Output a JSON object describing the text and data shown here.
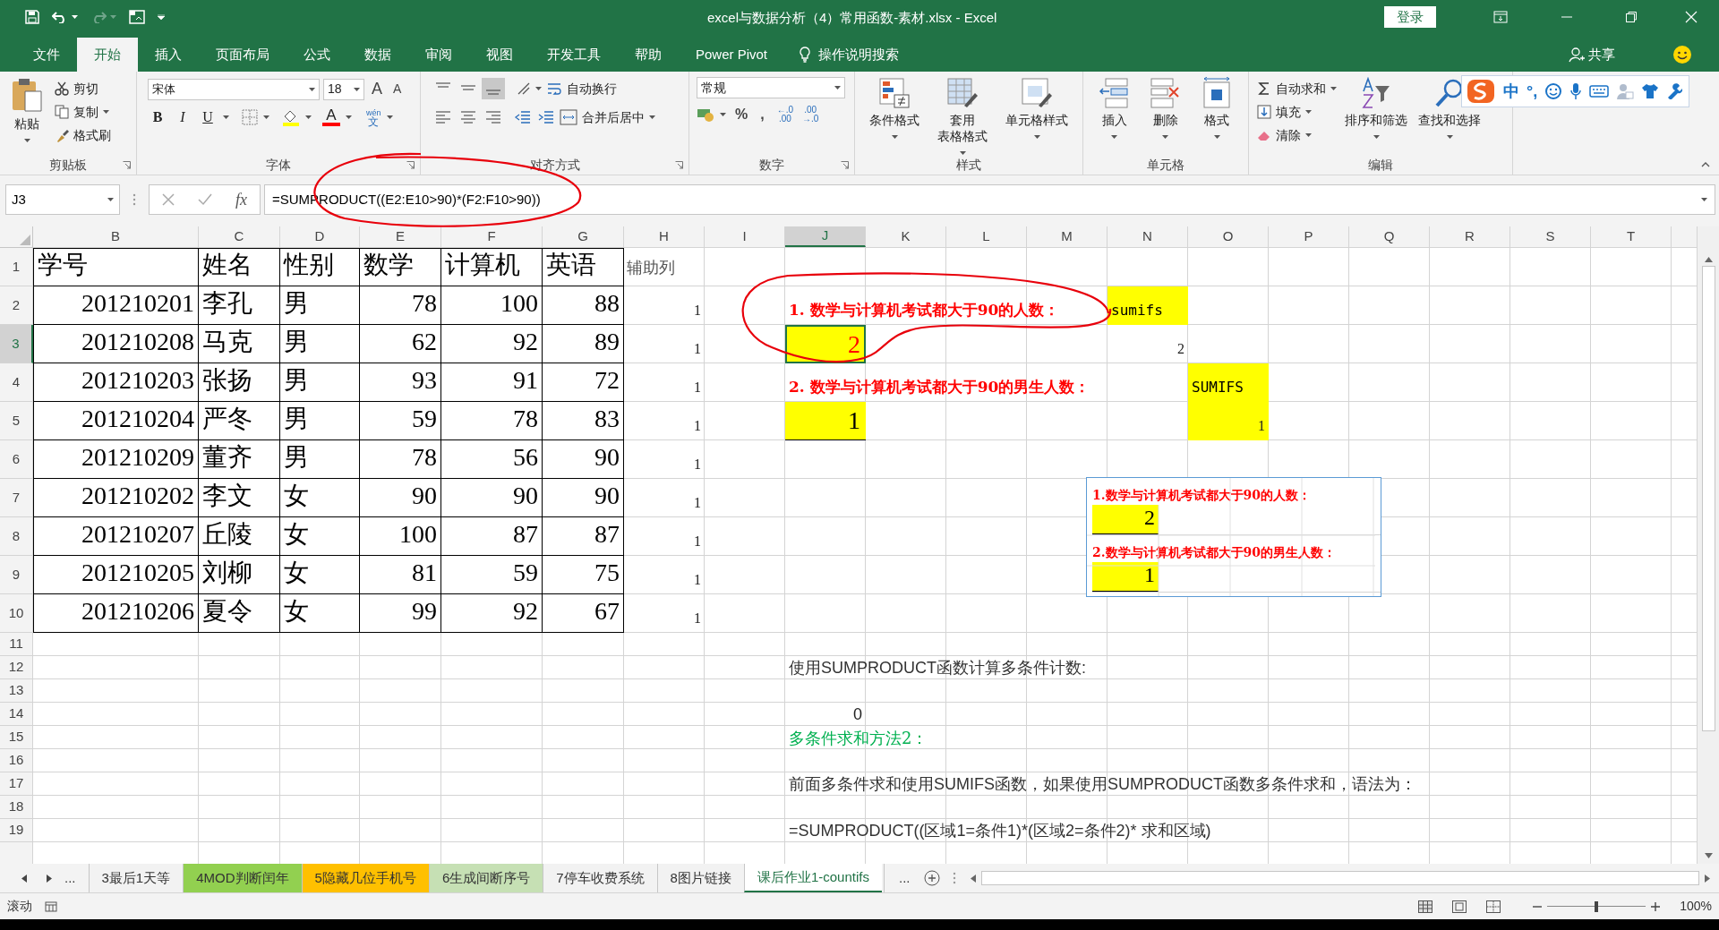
{
  "title_bar": {
    "title": "excel与数据分析（4）常用函数-素材.xlsx  -  Excel",
    "login": "登录"
  },
  "menu_tabs": [
    {
      "label": "文件",
      "selected": false
    },
    {
      "label": "开始",
      "selected": true
    },
    {
      "label": "插入",
      "selected": false
    },
    {
      "label": "页面布局",
      "selected": false
    },
    {
      "label": "公式",
      "selected": false
    },
    {
      "label": "数据",
      "selected": false
    },
    {
      "label": "审阅",
      "selected": false
    },
    {
      "label": "视图",
      "selected": false
    },
    {
      "label": "开发工具",
      "selected": false
    },
    {
      "label": "帮助",
      "selected": false
    },
    {
      "label": "Power Pivot",
      "selected": false
    }
  ],
  "tell_me": "操作说明搜索",
  "share": "共享",
  "ribbon": {
    "clipboard": {
      "label": "剪贴板",
      "paste": "粘贴",
      "items": [
        "剪切",
        "复制",
        "格式刷"
      ]
    },
    "font": {
      "label": "字体",
      "font": "宋体",
      "size": "18",
      "grow": "A",
      "shrink": "A",
      "styles": [
        "B",
        "I",
        "U"
      ],
      "font_color": "A",
      "phonetic": [
        "wén",
        "文"
      ]
    },
    "alignment": {
      "label": "对齐方式",
      "wrap": "自动换行",
      "merge": "合并后居中"
    },
    "number": {
      "label": "数字",
      "format": "常规",
      "symbols": [
        "%",
        ","
      ],
      "decimals": [
        [
          "←.0",
          ".00"
        ],
        [
          ".00",
          "→.0"
        ]
      ]
    },
    "styles": {
      "label": "样式",
      "buttons": [
        [
          "条件格式"
        ],
        [
          "套用",
          "表格格式"
        ],
        [
          "单元格样式"
        ]
      ]
    },
    "cells": {
      "label": "单元格",
      "buttons": [
        "插入",
        "删除",
        "格式"
      ]
    },
    "editing": {
      "label": "编辑",
      "items": [
        "自动求和",
        "填充",
        "清除"
      ],
      "buttons": [
        "排序和筛选",
        "查找和选择"
      ]
    }
  },
  "ime_toolbar": {
    "items": [
      "中",
      "°,"
    ]
  },
  "formula_bar": {
    "name_box": "J3",
    "fx": "fx",
    "formula": "=SUMPRODUCT((E2:E10>90)*(F2:F10>90))"
  },
  "sheet": {
    "columns": [
      {
        "label": "B",
        "selected": false
      },
      {
        "label": "C",
        "selected": false
      },
      {
        "label": "D",
        "selected": false
      },
      {
        "label": "E",
        "selected": false
      },
      {
        "label": "F",
        "selected": false
      },
      {
        "label": "G",
        "selected": false
      },
      {
        "label": "H",
        "selected": false
      },
      {
        "label": "I",
        "selected": false
      },
      {
        "label": "J",
        "selected": true
      },
      {
        "label": "K",
        "selected": false
      },
      {
        "label": "L",
        "selected": false
      },
      {
        "label": "M",
        "selected": false
      },
      {
        "label": "N",
        "selected": false
      },
      {
        "label": "O",
        "selected": false
      },
      {
        "label": "P",
        "selected": false
      },
      {
        "label": "Q",
        "selected": false
      },
      {
        "label": "R",
        "selected": false
      },
      {
        "label": "S",
        "selected": false
      },
      {
        "label": "T",
        "selected": false
      }
    ],
    "rows": [
      {
        "number": "1",
        "selected": false,
        "cells": [
          {
            "kind": "header",
            "text": "学号"
          },
          {
            "kind": "header",
            "text": "姓名"
          },
          {
            "kind": "header",
            "text": "性别"
          },
          {
            "kind": "header",
            "text": "数学"
          },
          {
            "kind": "header",
            "text": "计算机"
          },
          {
            "kind": "header",
            "text": "英语"
          },
          {
            "kind": "caption",
            "text": "辅助列"
          }
        ]
      },
      {
        "number": "2",
        "selected": false,
        "cells": [
          {
            "kind": "number",
            "text": "201210201"
          },
          {
            "kind": "header",
            "text": "李孔"
          },
          {
            "kind": "header",
            "text": "男"
          },
          {
            "kind": "number",
            "text": "78"
          },
          {
            "kind": "number",
            "text": "100"
          },
          {
            "kind": "number",
            "text": "88"
          },
          {
            "kind": "aux",
            "text": "1"
          },
          {
            "text": ""
          },
          {
            "kind": "label",
            "text": "1. 数学与计算机考试都大于90的人数："
          },
          {
            "text": ""
          },
          {
            "text": ""
          },
          {
            "text": ""
          },
          {
            "kind": "mono",
            "text": "sumifs",
            "color": "#ffff00"
          }
        ]
      },
      {
        "number": "3",
        "selected": true,
        "cells": [
          {
            "kind": "number",
            "text": "201210208"
          },
          {
            "kind": "header",
            "text": "马克"
          },
          {
            "kind": "header",
            "text": "男"
          },
          {
            "kind": "number",
            "text": "62"
          },
          {
            "kind": "number",
            "text": "92"
          },
          {
            "kind": "number",
            "text": "89"
          },
          {
            "kind": "aux",
            "text": "1"
          },
          {
            "text": ""
          },
          {
            "kind": "alert",
            "text": "2",
            "color": "#ffff00"
          },
          {
            "text": ""
          },
          {
            "text": ""
          },
          {
            "text": ""
          },
          {
            "kind": "aux",
            "text": "2"
          }
        ]
      },
      {
        "number": "4",
        "selected": false,
        "cells": [
          {
            "kind": "number",
            "text": "201210203"
          },
          {
            "kind": "header",
            "text": "张扬"
          },
          {
            "kind": "header",
            "text": "男"
          },
          {
            "kind": "number",
            "text": "93"
          },
          {
            "kind": "number",
            "text": "91"
          },
          {
            "kind": "number",
            "text": "72"
          },
          {
            "kind": "aux",
            "text": "1"
          },
          {
            "text": ""
          },
          {
            "kind": "label",
            "text": "2. 数学与计算机考试都大于90的男生人数："
          },
          {
            "text": ""
          },
          {
            "text": ""
          },
          {
            "text": ""
          },
          {
            "text": ""
          },
          {
            "kind": "mono",
            "text": "SUMIFS",
            "color": "#ffff00"
          }
        ]
      },
      {
        "number": "5",
        "selected": false,
        "cells": [
          {
            "kind": "number",
            "text": "201210204"
          },
          {
            "kind": "header",
            "text": "严冬"
          },
          {
            "kind": "header",
            "text": "男"
          },
          {
            "kind": "number",
            "text": "59"
          },
          {
            "kind": "number",
            "text": "78"
          },
          {
            "kind": "number",
            "text": "83"
          },
          {
            "kind": "aux",
            "text": "1"
          },
          {
            "text": ""
          },
          {
            "kind": "result",
            "text": "1",
            "color": "#ffff00"
          },
          {
            "text": ""
          },
          {
            "text": ""
          },
          {
            "text": ""
          },
          {
            "text": ""
          },
          {
            "kind": "aux",
            "text": "1",
            "color": "#ffff00"
          }
        ]
      },
      {
        "number": "6",
        "selected": false,
        "cells": [
          {
            "kind": "number",
            "text": "201210209"
          },
          {
            "kind": "header",
            "text": "董齐"
          },
          {
            "kind": "header",
            "text": "男"
          },
          {
            "kind": "number",
            "text": "78"
          },
          {
            "kind": "number",
            "text": "56"
          },
          {
            "kind": "number",
            "text": "90"
          },
          {
            "kind": "aux",
            "text": "1"
          }
        ]
      },
      {
        "number": "7",
        "selected": false,
        "cells": [
          {
            "kind": "number",
            "text": "201210202"
          },
          {
            "kind": "header",
            "text": "李文"
          },
          {
            "kind": "header",
            "text": "女"
          },
          {
            "kind": "number",
            "text": "90"
          },
          {
            "kind": "number",
            "text": "90"
          },
          {
            "kind": "number",
            "text": "90"
          },
          {
            "kind": "aux",
            "text": "1"
          }
        ]
      },
      {
        "number": "8",
        "selected": false,
        "cells": [
          {
            "kind": "number",
            "text": "201210207"
          },
          {
            "kind": "header",
            "text": "丘陵"
          },
          {
            "kind": "header",
            "text": "女"
          },
          {
            "kind": "number",
            "text": "100"
          },
          {
            "kind": "number",
            "text": "87"
          },
          {
            "kind": "number",
            "text": "87"
          },
          {
            "kind": "aux",
            "text": "1"
          }
        ]
      },
      {
        "number": "9",
        "selected": false,
        "cells": [
          {
            "kind": "number",
            "text": "201210205"
          },
          {
            "kind": "header",
            "text": "刘柳"
          },
          {
            "kind": "header",
            "text": "女"
          },
          {
            "kind": "number",
            "text": "81"
          },
          {
            "kind": "number",
            "text": "59"
          },
          {
            "kind": "number",
            "text": "75"
          },
          {
            "kind": "aux",
            "text": "1"
          }
        ]
      },
      {
        "number": "10",
        "selected": false,
        "cells": [
          {
            "kind": "number",
            "text": "201210206"
          },
          {
            "kind": "header",
            "text": "夏令"
          },
          {
            "kind": "header",
            "text": "女"
          },
          {
            "kind": "number",
            "text": "99"
          },
          {
            "kind": "number",
            "text": "92"
          },
          {
            "kind": "number",
            "text": "67"
          },
          {
            "kind": "aux",
            "text": "1"
          }
        ]
      },
      {
        "number": "11",
        "selected": false,
        "cells": []
      },
      {
        "number": "12",
        "selected": false,
        "cells": [
          {
            "text": ""
          },
          {
            "text": ""
          },
          {
            "text": ""
          },
          {
            "text": ""
          },
          {
            "text": ""
          },
          {
            "text": ""
          },
          {
            "text": ""
          },
          {
            "text": ""
          },
          {
            "kind": "plain",
            "text": "使用SUMPRODUCT函数计算多条件计数:"
          }
        ]
      },
      {
        "number": "13",
        "selected": false,
        "cells": []
      },
      {
        "number": "14",
        "selected": false,
        "cells": [
          {
            "text": ""
          },
          {
            "text": ""
          },
          {
            "text": ""
          },
          {
            "text": ""
          },
          {
            "text": ""
          },
          {
            "text": ""
          },
          {
            "text": ""
          },
          {
            "text": ""
          },
          {
            "kind": "value",
            "text": "0"
          }
        ]
      },
      {
        "number": "15",
        "selected": false,
        "cells": [
          {
            "text": ""
          },
          {
            "text": ""
          },
          {
            "text": ""
          },
          {
            "text": ""
          },
          {
            "text": ""
          },
          {
            "text": ""
          },
          {
            "text": ""
          },
          {
            "text": ""
          },
          {
            "kind": "note",
            "text": "多条件求和方法2："
          }
        ]
      },
      {
        "number": "16",
        "selected": false,
        "cells": []
      },
      {
        "number": "17",
        "selected": false,
        "cells": [
          {
            "text": ""
          },
          {
            "text": ""
          },
          {
            "text": ""
          },
          {
            "text": ""
          },
          {
            "text": ""
          },
          {
            "text": ""
          },
          {
            "text": ""
          },
          {
            "text": ""
          },
          {
            "kind": "plain",
            "text": "前面多条件求和使用SUMIFS函数，如果使用SUMPRODUCT函数多条件求和，语法为："
          }
        ]
      },
      {
        "number": "18",
        "selected": false,
        "cells": []
      },
      {
        "number": "19",
        "selected": false,
        "cells": [
          {
            "text": ""
          },
          {
            "text": ""
          },
          {
            "text": ""
          },
          {
            "text": ""
          },
          {
            "text": ""
          },
          {
            "text": ""
          },
          {
            "text": ""
          },
          {
            "text": ""
          },
          {
            "kind": "plain",
            "text": "=SUMPRODUCT((区域1=条件1)*(区域2=条件2)* 求和区域)"
          }
        ]
      }
    ]
  },
  "text_box": {
    "items": [
      {
        "kind": "label",
        "text": "1.数学与计算机考试都大于90的人数："
      },
      {
        "kind": "result",
        "text": "2"
      },
      {
        "kind": "label",
        "text": "2.数学与计算机考试都大于90的男生人数："
      },
      {
        "kind": "result",
        "text": "1"
      }
    ]
  },
  "markup": [
    {
      "kind": "loop"
    },
    {
      "kind": "loop"
    }
  ],
  "sheet_tabs": {
    "more_left": "...",
    "tabs": [
      {
        "label": "3最后1天等",
        "color": "#f2f2f2",
        "selected": false
      },
      {
        "label": "4MOD判断闰年",
        "color": "#92d050",
        "selected": false
      },
      {
        "label": "5隐藏几位手机号",
        "color": "#ffc000",
        "selected": false
      },
      {
        "label": "6生成间断序号",
        "color": "#c6e0b4",
        "selected": false
      },
      {
        "label": "7停车收费系统",
        "color": "#f2f2f2",
        "selected": false
      },
      {
        "label": "8图片链接",
        "color": "#f2f2f2",
        "selected": false
      },
      {
        "label": "课后作业1-countifs",
        "color": "#ffffff",
        "selected": true
      }
    ],
    "more_right": "..."
  },
  "status_bar": {
    "mode": "滚动",
    "zoom": "100%",
    "zoom_slider": {
      "level": 0.5
    }
  }
}
